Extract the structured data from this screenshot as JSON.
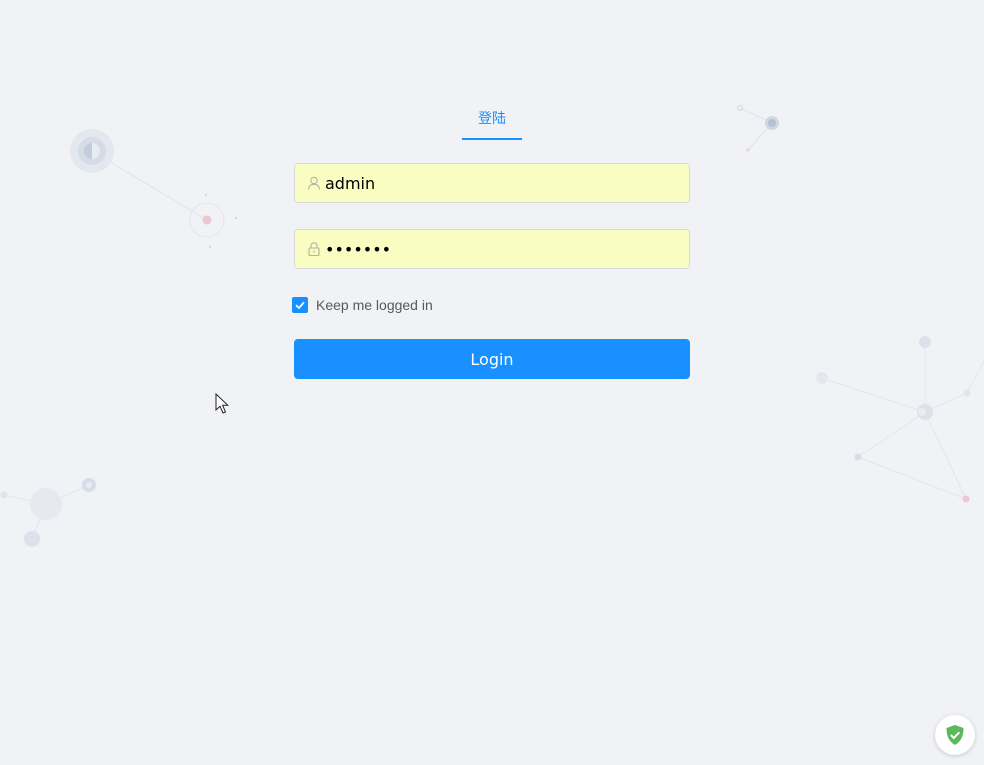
{
  "tabs": [
    {
      "label": "登陆",
      "active": true
    }
  ],
  "form": {
    "username": {
      "value": "admin",
      "placeholder": "",
      "icon": "user-icon"
    },
    "password": {
      "value": "*******",
      "placeholder": "",
      "icon": "lock-icon"
    },
    "remember": {
      "label": "Keep me logged in",
      "checked": true
    },
    "submit_label": "Login"
  },
  "colors": {
    "accent": "#1890ff",
    "autofill": "#fafdc1",
    "background": "#f0f2f5",
    "shield": "#5cb85c"
  }
}
